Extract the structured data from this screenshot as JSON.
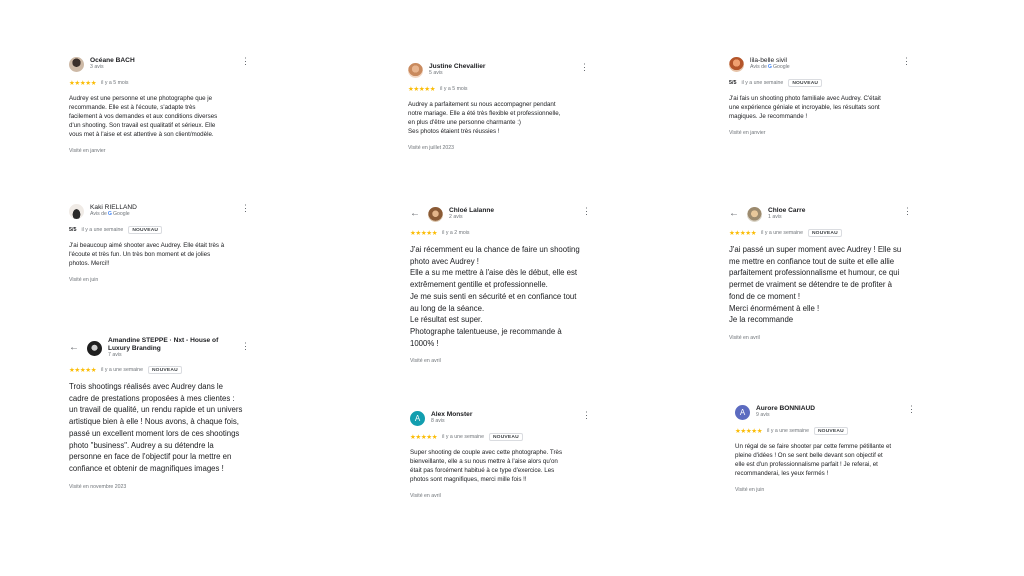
{
  "reviews": [
    {
      "name": "Océane BACH",
      "sub": "3 avis",
      "date": "il y a 5 mois",
      "text": "Audrey est une personne et une photographe que je\nrecommande. Elle est à l'écoute, s'adapte très\nfacilement à vos demandes et aux conditions diverses\nd'un shooting. Son travail est qualitatif et sérieux. Elle\nvous met à l'aise et est attentive à son client/modèle.",
      "visited": "Visité en janvier"
    },
    {
      "name": "Justine Chevallier",
      "sub": "5 avis",
      "date": "il y a 5 mois",
      "text": "Audrey a parfaitement su nous accompagner pendant\nnotre mariage. Elle a été très flexible et professionnelle,\nen plus d'être une personne charmante :)\nSes photos étaient très réussies !",
      "visited": "Visité en juillet 2023"
    },
    {
      "name": "lila-belle sivil",
      "sub_prefix": "Avis de",
      "sub_brand": "Google",
      "score": "5/5",
      "date": "il y a une semaine",
      "badge": "NOUVEAU",
      "text": "J'ai fais un shooting photo familiale avec Audrey. C'était\nune expérience géniale et incroyable, les résultats sont\nmagiques. Je recommande !",
      "visited": "Visité en janvier"
    },
    {
      "name": "Kaki RIELLAND",
      "sub_prefix": "Avis de",
      "sub_brand": "Google",
      "score": "5/5",
      "date": "il y a une semaine",
      "badge": "NOUVEAU",
      "text": "J'ai beaucoup aimé shooter avec Audrey. Elle était très à\nl'écoute et très fun. Un très bon moment et de jolies\nphotos. Merci!!",
      "visited": "Visité en juin"
    },
    {
      "name": "Chloé Lalanne",
      "sub": "2 avis",
      "date": "il y a 2 mois",
      "text": "J'ai récemment eu la chance de faire un shooting\nphoto avec Audrey !\nElle a su me mettre à l'aise dès le début, elle est\nextrêmement gentille et professionnelle.\nJe me suis senti en sécurité et en confiance tout\nau long de la séance.\nLe résultat est super.\nPhotographe talentueuse, je recommande à\n1000% !",
      "visited": "Visité en avril"
    },
    {
      "name": "Chloe Carre",
      "sub": "1 avis",
      "date": "il y a une semaine",
      "badge": "NOUVEAU",
      "text": "J'ai passé un super moment avec Audrey ! Elle su\nme mettre en confiance tout de suite et elle allie\nparfaitement professionnalisme et humour, ce qui\npermet de vraiment se détendre te de profiter à\nfond de ce moment !\nMerci énormément à elle !\nJe la recommande",
      "visited": "Visité en avril"
    },
    {
      "name_line1": "Amandine STEPPE · Nxt - House of",
      "name_line2": "Luxury Branding",
      "sub": "7 avis",
      "date": "il y a une semaine",
      "badge": "NOUVEAU",
      "text": "Trois shootings réalisés avec Audrey dans le\ncadre de prestations proposées à mes clientes :\nun travail de qualité, un rendu rapide et un univers\nartistique bien à elle ! Nous avons, à chaque fois,\npassé un excellent moment lors de ces shootings\nphoto \"business\". Audrey a su détendre la\npersonne en face de l'objectif pour la mettre en\nconfiance et obtenir de magnifiques images !",
      "visited": "Visité en novembre 2023"
    },
    {
      "name": "Alex Monster",
      "sub": "8 avis",
      "initial": "A",
      "date": "il y a une semaine",
      "badge": "NOUVEAU",
      "text": "Super shooting de couple avec cette photographe. Très\nbienveillante, elle a su nous mettre à l'aise alors qu'on\nétait pas forcément habitué à ce type d'exercice. Les\nphotos sont magnifiques, merci mille fois !!",
      "visited": "Visité en avril"
    },
    {
      "name": "Aurore BONNIAUD",
      "sub": "9 avis",
      "initial": "A",
      "date": "il y a une semaine",
      "badge": "NOUVEAU",
      "text": "Un régal de se faire shooter par cette femme pétillante et\npleine d'idées ! On se sent belle devant son objectif et\nelle est d'un professionnalisme parfait ! Je referai, et\nrecommanderai, les yeux fermés !",
      "visited": "Visité en juin"
    }
  ],
  "ui": {
    "stars": "★★★★★",
    "more": "⋮",
    "back": "←"
  },
  "colors": {
    "star": "#fbbc04",
    "avatar_teal": "#129eaf",
    "avatar_purple": "#5c6bc0"
  },
  "icons": {
    "more": "more-vert-icon",
    "back": "arrow-back-icon",
    "star": "star-icon",
    "google": "google-logo-icon"
  }
}
